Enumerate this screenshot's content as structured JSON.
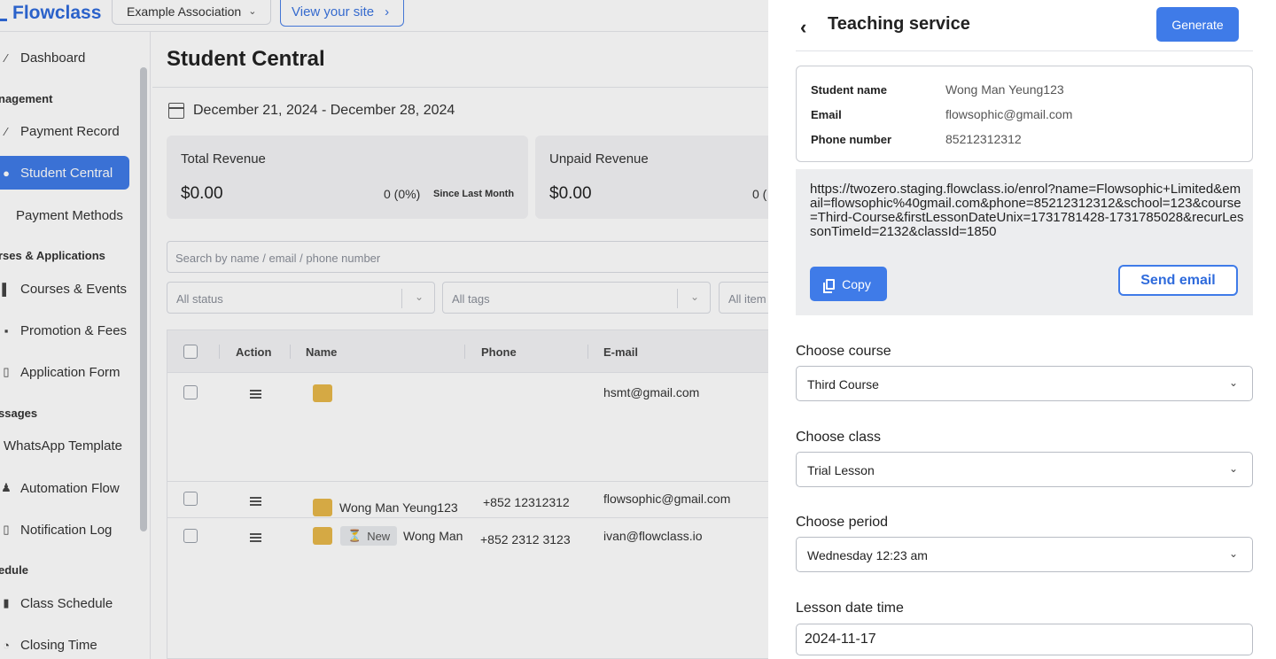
{
  "topbar": {
    "logo": "Flowclass",
    "org": "Example Association",
    "view_site": "View your site"
  },
  "sidebar": {
    "items": [
      {
        "label": "Dashboard"
      },
      {
        "section": "nagement"
      },
      {
        "label": "Payment Record"
      },
      {
        "label": "Student Central"
      },
      {
        "label": "Payment Methods"
      },
      {
        "section": "rses & Applications"
      },
      {
        "label": "Courses & Events"
      },
      {
        "label": "Promotion & Fees"
      },
      {
        "label": "Application Form"
      },
      {
        "section": "ssages"
      },
      {
        "label": "WhatsApp Template"
      },
      {
        "label": "Automation Flow"
      },
      {
        "label": "Notification Log"
      },
      {
        "section": "edule"
      },
      {
        "label": "Class Schedule"
      },
      {
        "label": "Closing Time"
      }
    ]
  },
  "main": {
    "title": "Student Central",
    "date_range": "December 21, 2024 - December 28, 2024",
    "cards": [
      {
        "label": "Total Revenue",
        "value": "$0.00",
        "change": "0 (0%)",
        "since": "Since Last Month"
      },
      {
        "label": "Unpaid Revenue",
        "value": "$0.00",
        "change": "0 ("
      }
    ],
    "search_placeholder": "Search by name / email / phone number",
    "filters": [
      "All status",
      "All tags",
      "All item"
    ],
    "table": {
      "headers": [
        "Action",
        "Name",
        "Phone",
        "E-mail"
      ],
      "rows": [
        {
          "name": "",
          "phone": "",
          "email": "hsmt@gmail.com"
        },
        {
          "name": "Wong Man Yeung123",
          "phone": "+852 12312312",
          "email": "flowsophic@gmail.com"
        },
        {
          "tag": "New",
          "name": "Wong Man",
          "phone": "+852 2312 3123",
          "email": "ivan@flowclass.io"
        }
      ]
    }
  },
  "drawer": {
    "title": "Teaching service",
    "generate": "Generate",
    "info": [
      {
        "key": "Student name",
        "value": "Wong Man Yeung123"
      },
      {
        "key": "Email",
        "value": "flowsophic@gmail.com"
      },
      {
        "key": "Phone number",
        "value": "85212312312"
      }
    ],
    "link": "https://twozero.staging.flowclass.io/enrol?name=Flowsophic+Limited&email=flowsophic%40gmail.com&phone=85212312312&school=123&course=Third-Course&firstLessonDateUnix=1731781428-1731785028&recurLessonTimeId=2132&classId=1850",
    "copy": "Copy",
    "send_email": "Send email",
    "fields": [
      {
        "label": "Choose course",
        "value": "Third Course"
      },
      {
        "label": "Choose class",
        "value": "Trial Lesson"
      },
      {
        "label": "Choose period",
        "value": "Wednesday 12:23 am"
      }
    ],
    "date_label": "Lesson date time",
    "date_value": "2024-11-17"
  }
}
